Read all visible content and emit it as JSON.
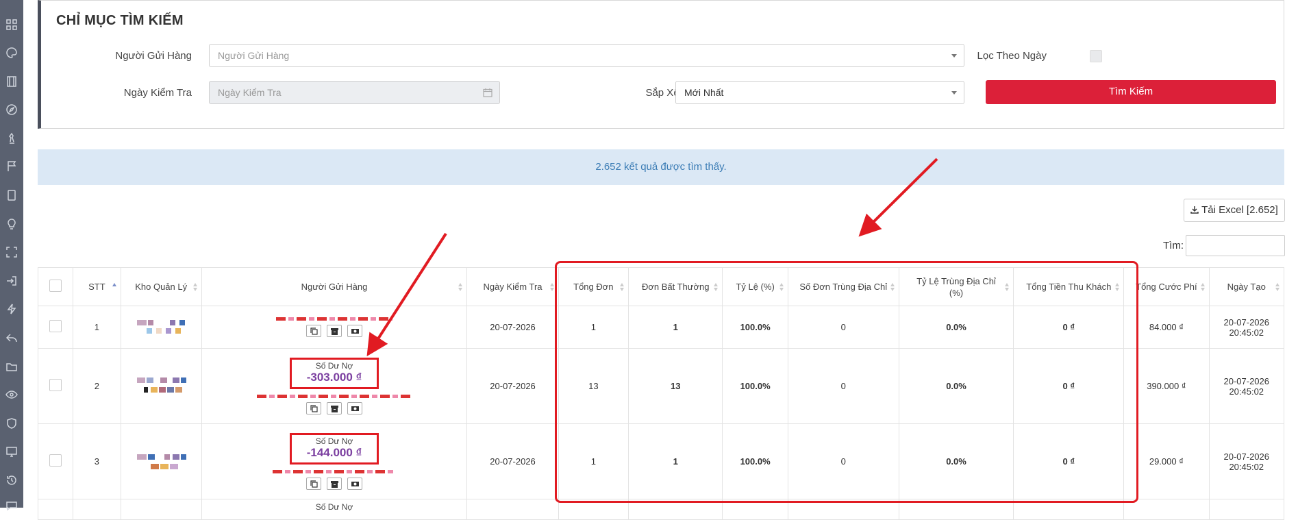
{
  "search": {
    "title": "CHỈ MỤC TÌM KIẾM",
    "sender_label": "Người Gửi Hàng",
    "sender_placeholder": "Người Gửi Hàng",
    "date_label": "Ngày Kiểm Tra",
    "date_placeholder": "Ngày Kiểm Tra",
    "sort_label": "Sắp Xếp",
    "sort_value": "Mới Nhất",
    "filter_by_date_label": "Lọc Theo Ngày",
    "search_button": "Tìm Kiếm"
  },
  "results": {
    "summary": "2.652 kết quả được tìm thấy.",
    "excel_button": "Tải Excel [2.652]",
    "find_label": "Tìm:"
  },
  "table": {
    "headers": {
      "stt": "STT",
      "warehouse": "Kho Quản Lý",
      "sender": "Người Gửi Hàng",
      "check_date": "Ngày Kiểm Tra",
      "total_orders": "Tổng Đơn",
      "abnormal_orders": "Đơn Bất Thường",
      "ratio": "Tỷ Lệ (%)",
      "dup_address_orders": "Số Đơn Trùng Địa Chỉ",
      "dup_address_ratio": "Tỷ Lệ Trùng Địa Chỉ (%)",
      "total_collected": "Tổng Tiền Thu Khách",
      "total_fee": "Tổng Cước Phí",
      "created_date": "Ngày Tạo"
    },
    "debt_label": "Số Dư Nợ",
    "rows": [
      {
        "stt": "1",
        "debt": "",
        "check_date": "20-07-2026",
        "total_orders": "1",
        "abnormal": "1",
        "ratio": "100.0%",
        "dup_orders": "0",
        "dup_ratio": "0.0%",
        "collected": "0 ₫",
        "fee": "84.000 ₫",
        "created_date": "20-07-2026",
        "created_time": "20:45:02"
      },
      {
        "stt": "2",
        "debt": "-303.000 ₫",
        "check_date": "20-07-2026",
        "total_orders": "13",
        "abnormal": "13",
        "ratio": "100.0%",
        "dup_orders": "0",
        "dup_ratio": "0.0%",
        "collected": "0 ₫",
        "fee": "390.000 ₫",
        "created_date": "20-07-2026",
        "created_time": "20:45:02"
      },
      {
        "stt": "3",
        "debt": "-144.000 ₫",
        "check_date": "20-07-2026",
        "total_orders": "1",
        "abnormal": "1",
        "ratio": "100.0%",
        "dup_orders": "0",
        "dup_ratio": "0.0%",
        "collected": "0 ₫",
        "fee": "29.000 ₫",
        "created_date": "20-07-2026",
        "created_time": "20:45:02"
      }
    ]
  },
  "colors": {
    "accent_red": "#dc2039",
    "annotation_red": "#e11b22",
    "info_bg": "#dbe8f5",
    "debt_purple": "#7b3fa0"
  },
  "icons": [
    "grid-icon",
    "palette-icon",
    "film-icon",
    "compass-icon",
    "chess-icon",
    "flag-icon",
    "tablet-icon",
    "bulb-icon",
    "expand-icon",
    "login-icon",
    "bolt-icon",
    "reply-icon",
    "folder-icon",
    "eye-icon",
    "shield-icon",
    "monitor-icon",
    "history-icon",
    "chat-icon",
    "copy-icon",
    "archive-icon",
    "money-icon",
    "download-icon",
    "calendar-icon"
  ]
}
